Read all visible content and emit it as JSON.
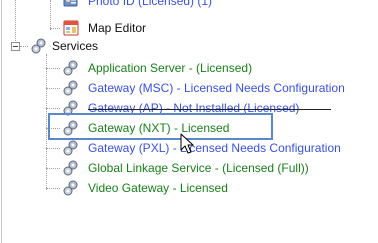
{
  "tree": {
    "top_items": [
      {
        "label": "Photo ID (Licensed) (1)",
        "color": "#3a52d6"
      },
      {
        "label": "Map Editor",
        "color": "#111111"
      }
    ],
    "services": {
      "label": "Services",
      "expander_state": "expanded",
      "children": [
        {
          "label": "Application Server - (Licensed)",
          "status": "licensed"
        },
        {
          "label": "Gateway (MSC) - Licensed Needs Configuration",
          "status": "needs-config"
        },
        {
          "label": "Gateway (AP) - Not Installed (Licensed)",
          "status": "not-installed"
        },
        {
          "label": "Gateway (NXT) - Licensed",
          "status": "licensed",
          "selected": true
        },
        {
          "label": "Gateway (PXL) - Licensed Needs Configuration",
          "status": "needs-config"
        },
        {
          "label": "Global Linkage Service - (Licensed (Full))",
          "status": "licensed"
        },
        {
          "label": "Video Gateway - Licensed",
          "status": "licensed"
        }
      ]
    }
  },
  "colors": {
    "licensed": "#1c7d1c",
    "needs_config": "#3a52d6",
    "selection_border": "#5b88c8"
  }
}
